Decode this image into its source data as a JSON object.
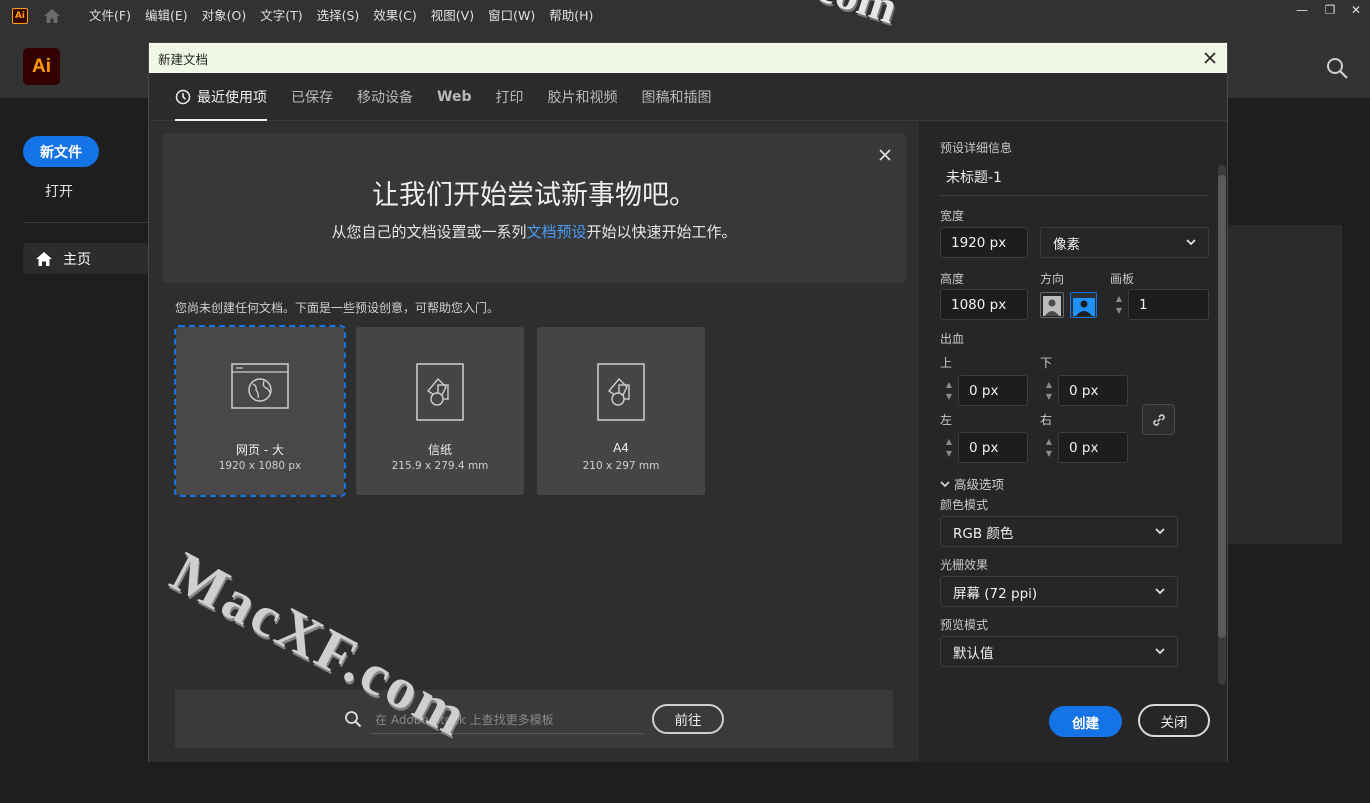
{
  "menubar": {
    "app_badge": "Ai",
    "items": [
      "文件(F)",
      "编辑(E)",
      "对象(O)",
      "文字(T)",
      "选择(S)",
      "效果(C)",
      "视图(V)",
      "窗口(W)",
      "帮助(H)"
    ],
    "window_controls": [
      "—",
      "❐",
      "✕"
    ]
  },
  "appbar": {
    "logo": "Ai"
  },
  "sidebar": {
    "new_file": "新文件",
    "open": "打开",
    "home": "主页"
  },
  "dialog": {
    "title": "新建文档",
    "tabs": [
      "最近使用项",
      "已保存",
      "移动设备",
      "Web",
      "打印",
      "胶片和视频",
      "图稿和插图"
    ],
    "banner": {
      "title": "让我们开始尝试新事物吧。",
      "sub_before": "从您自己的文档设置或一系列",
      "sub_link": "文档预设",
      "sub_after": "开始以快速开始工作。"
    },
    "hint": "您尚未创建任何文档。下面是一些预设创意，可帮助您入门。",
    "presets": [
      {
        "name": "网页 - 大",
        "size": "1920 x 1080 px",
        "icon": "web-icon"
      },
      {
        "name": "信纸",
        "size": "215.9 x 279.4 mm",
        "icon": "document-icon"
      },
      {
        "name": "A4",
        "size": "210 x 297 mm",
        "icon": "document-icon"
      }
    ],
    "stock": {
      "placeholder": "在 Adobe Stock 上查找更多模板",
      "go": "前往"
    },
    "details": {
      "section_title": "预设详细信息",
      "doc_name": "未标题-1",
      "width_label": "宽度",
      "width": "1920 px",
      "unit": "像素",
      "height_label": "高度",
      "height": "1080 px",
      "orientation_label": "方向",
      "artboards_label": "画板",
      "artboards": "1",
      "bleed_label": "出血",
      "top_label": "上",
      "bottom_label": "下",
      "left_label": "左",
      "right_label": "右",
      "bleed_top": "0 px",
      "bleed_bottom": "0 px",
      "bleed_left": "0 px",
      "bleed_right": "0 px",
      "advanced": "高级选项",
      "color_mode_label": "颜色模式",
      "color_mode": "RGB 颜色",
      "raster_label": "光栅效果",
      "raster": "屏幕 (72 ppi)",
      "preview_label": "预览模式",
      "preview": "默认值",
      "create": "创建",
      "close": "关闭"
    }
  },
  "watermark": {
    "text": "MacXF.com",
    "top_fragment": "com"
  },
  "colors": {
    "accent": "#1473e6",
    "brand_orange": "#ff9a00",
    "title_bar": "#f1f8e5"
  }
}
